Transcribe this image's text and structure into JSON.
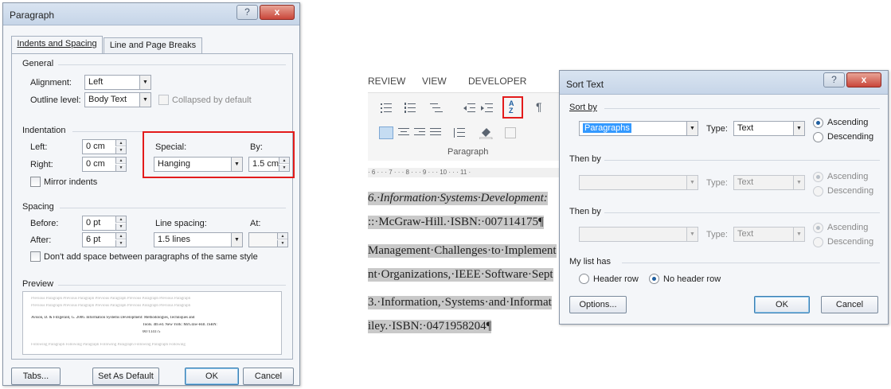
{
  "paragraph_dialog": {
    "title": "Paragraph",
    "help_glyph": "?",
    "close_glyph": "x",
    "tabs": [
      {
        "label": "Indents and Spacing"
      },
      {
        "label": "Line and Page Breaks"
      }
    ],
    "general": {
      "section": "General",
      "alignment_label": "Alignment:",
      "alignment_value": "Left",
      "outline_label": "Outline level:",
      "outline_value": "Body Text",
      "collapsed_label": "Collapsed by default"
    },
    "indentation": {
      "section": "Indentation",
      "left_label": "Left:",
      "left_value": "0 cm",
      "right_label": "Right:",
      "right_value": "0 cm",
      "special_label": "Special:",
      "special_value": "Hanging",
      "by_label": "By:",
      "by_value": "1.5 cm",
      "mirror_label": "Mirror indents"
    },
    "spacing": {
      "section": "Spacing",
      "before_label": "Before:",
      "before_value": "0 pt",
      "after_label": "After:",
      "after_value": "6 pt",
      "line_spacing_label": "Line spacing:",
      "line_spacing_value": "1.5 lines",
      "at_label": "At:",
      "at_value": "",
      "dont_add_label": "Don't add space between paragraphs of the same style"
    },
    "preview": {
      "section": "Preview",
      "prev_line1": "Previous Paragraph Previous Paragraph Previous Paragraph Previous Paragraph Previous Paragraph",
      "prev_line2": "Previous Paragraph Previous Paragraph Previous Paragraph Previous Paragraph Previous Paragraph",
      "sample_line1": "Avison, D. & Fitzgerald, G. 2006. Information Systems Development: Methodologies, Techniques and",
      "sample_line2": "Tools. 4th ed. New York: McGraw-Hill. ISBN:",
      "sample_line3": "007114175",
      "follow_line": "Following Paragraph Following Paragraph Following Paragraph Following Paragraph Following"
    },
    "buttons": {
      "tabs": "Tabs...",
      "set_default": "Set As Default",
      "ok": "OK",
      "cancel": "Cancel"
    }
  },
  "word_background": {
    "ribbon_tabs": [
      "REVIEW",
      "VIEW",
      "DEVELOPER"
    ],
    "paragraph_group_label": "Paragraph",
    "ruler_text": "· 6 · · · 7 · · · 8 · · · 9 · · · 10 · · · 11 ·",
    "doc_lines": [
      "6.·Information·Systems·Development:",
      "::·McGraw-Hill.·ISBN:·007114175¶",
      "Management·Challenges·to·Implement",
      "nt·Organizations,·IEEE·Software·Sept",
      "3.·Information,·Systems·and·Informat",
      "iley.·ISBN:·0471958204¶"
    ]
  },
  "sort_dialog": {
    "title": "Sort Text",
    "help_glyph": "?",
    "close_glyph": "x",
    "sort_by": {
      "section": "Sort by",
      "field_value": "Paragraphs",
      "type_label": "Type:",
      "type_value": "Text",
      "ascending": "Ascending",
      "descending": "Descending"
    },
    "then_by_1": {
      "section": "Then by",
      "type_label": "Type:",
      "type_value": "Text",
      "ascending": "Ascending",
      "descending": "Descending"
    },
    "then_by_2": {
      "section": "Then by",
      "type_label": "Type:",
      "type_value": "Text",
      "ascending": "Ascending",
      "descending": "Descending"
    },
    "my_list_has": {
      "section": "My list has",
      "header_row": "Header row",
      "no_header_row": "No header row"
    },
    "buttons": {
      "options": "Options...",
      "ok": "OK",
      "cancel": "Cancel"
    }
  },
  "colors": {
    "highlight_red": "#e31b1b",
    "selection_blue": "#3399ff",
    "doc_selection_gray": "#c9c9c9",
    "close_button_red": "#c9463a"
  }
}
